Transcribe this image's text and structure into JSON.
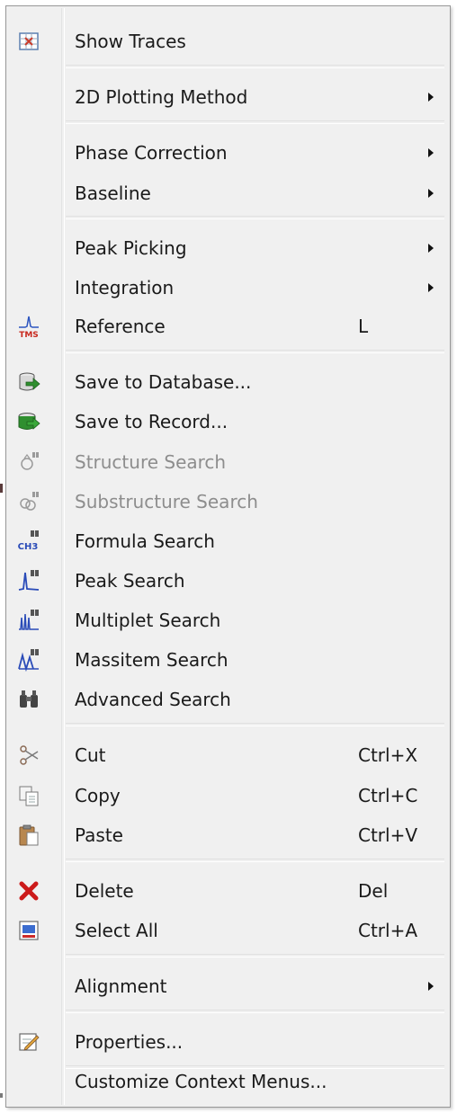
{
  "menu": {
    "items": [
      {
        "label": "Show Traces",
        "icon": "traces-icon"
      },
      {
        "label": "2D Plotting Method",
        "submenu": true
      },
      {
        "label": "Phase Correction",
        "submenu": true
      },
      {
        "label": "Baseline",
        "submenu": true
      },
      {
        "label": "Peak Picking",
        "submenu": true
      },
      {
        "label": "Integration",
        "submenu": true
      },
      {
        "label": "Reference",
        "shortcut": "L",
        "icon": "tms-reference-icon",
        "icon_text": "TMS"
      },
      {
        "label": "Save to Database...",
        "icon": "save-database-icon"
      },
      {
        "label": "Save to Record...",
        "icon": "save-record-icon"
      },
      {
        "label": "Structure Search",
        "disabled": true,
        "icon": "structure-search-icon"
      },
      {
        "label": "Substructure Search",
        "disabled": true,
        "icon": "substructure-search-icon"
      },
      {
        "label": "Formula Search",
        "icon": "formula-search-icon",
        "icon_text": "CH3"
      },
      {
        "label": "Peak Search",
        "icon": "peak-search-icon"
      },
      {
        "label": "Multiplet Search",
        "icon": "multiplet-search-icon"
      },
      {
        "label": "Massitem Search",
        "icon": "massitem-search-icon"
      },
      {
        "label": "Advanced Search",
        "icon": "binoculars-icon"
      },
      {
        "label": "Cut",
        "shortcut": "Ctrl+X",
        "icon": "scissors-icon"
      },
      {
        "label": "Copy",
        "shortcut": "Ctrl+C",
        "icon": "copy-icon"
      },
      {
        "label": "Paste",
        "shortcut": "Ctrl+V",
        "icon": "paste-icon"
      },
      {
        "label": "Delete",
        "shortcut": "Del",
        "icon": "delete-x-icon"
      },
      {
        "label": "Select All",
        "shortcut": "Ctrl+A",
        "icon": "select-all-icon"
      },
      {
        "label": "Alignment",
        "submenu": true
      },
      {
        "label": "Properties...",
        "icon": "properties-icon"
      },
      {
        "label": "Customize Context Menus..."
      }
    ]
  },
  "colors": {
    "menu_bg": "#f0f0f0",
    "text": "#1a1a1a",
    "disabled_text": "#8d8d8d",
    "delete_red": "#cc1a1a",
    "save_green": "#2f8f2f",
    "search_blue": "#2a4bb8"
  }
}
